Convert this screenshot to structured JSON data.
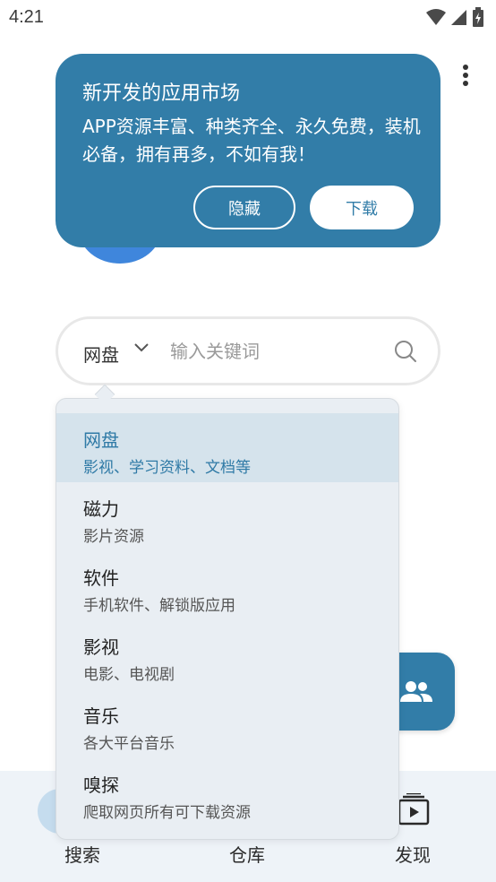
{
  "status_bar": {
    "time": "4:21"
  },
  "promo": {
    "title": "新开发的应用市场",
    "description": "APP资源丰富、种类齐全、永久免费，装机必备，拥有再多，不如有我！",
    "hide_label": "隐藏",
    "download_label": "下载"
  },
  "search": {
    "type_label": "网盘",
    "placeholder": "输入关键词"
  },
  "dropdown": {
    "items": [
      {
        "title": "网盘",
        "subtitle": "影视、学习资料、文档等",
        "selected": true
      },
      {
        "title": "磁力",
        "subtitle": "影片资源"
      },
      {
        "title": "软件",
        "subtitle": "手机软件、解锁版应用"
      },
      {
        "title": "影视",
        "subtitle": "电影、电视剧"
      },
      {
        "title": "音乐",
        "subtitle": "各大平台音乐"
      },
      {
        "title": "嗅探",
        "subtitle": "爬取网页所有可下载资源"
      }
    ]
  },
  "bottom_nav": {
    "items": [
      {
        "label": "搜索",
        "icon": "search-icon"
      },
      {
        "label": "仓库",
        "icon": "warehouse-icon"
      },
      {
        "label": "发现",
        "icon": "play-box-icon"
      }
    ]
  },
  "fab": {
    "icon": "people-icon"
  },
  "colors": {
    "accent": "#327da8",
    "dropdown_bg": "#e9eef3",
    "selected_bg": "#d5e3ec",
    "nav_bg": "#eef3f8"
  }
}
